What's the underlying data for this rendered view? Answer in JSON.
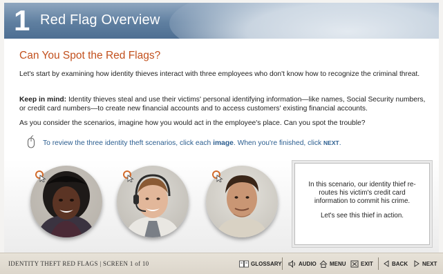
{
  "header": {
    "number": "1",
    "title": "Red Flag Overview"
  },
  "content": {
    "heading": "Can You Spot the Red Flags?",
    "intro": "Let's start by examining how identity thieves interact with three employees who don't know how to recognize the criminal threat.",
    "keep_in_mind_label": "Keep in mind:",
    "keep_in_mind_text": " Identity thieves steal and use their victims' personal identifying information—like names, Social Security numbers, or credit card numbers—to create new financial accounts and to access customers' existing financial accounts.",
    "consider": "As you consider the scenarios, imagine how you would act in the employee's place. Can you spot the trouble?",
    "instruction": {
      "part1": "To review the three identity theft scenarios, click each ",
      "bold": "image",
      "part2": ". When you're finished, click ",
      "next": "NEXT",
      "part3": "."
    }
  },
  "scenario": {
    "text": "In this scenario, our identity thief re-routes his victim's credit card information to commit his crime.",
    "cta": "Let's see this thief in action."
  },
  "footer": {
    "course": "IDENTITY THEFT RED FLAGS",
    "screen": "SCREEN 1 of 10",
    "divider": "|",
    "glossary": "GLOSSARY",
    "audio": "AUDIO",
    "menu": "MENU",
    "exit": "EXIT",
    "back": "BACK",
    "next": "NEXT"
  },
  "colors": {
    "heading": "#c2501d",
    "instruction": "#2a5d8f",
    "header": "#5f7fa0",
    "footer": "#e2ddd2"
  },
  "icons": [
    "mouse-icon",
    "click-cursor-icon",
    "glossary-icon",
    "audio-icon",
    "menu-home-icon",
    "exit-icon",
    "back-arrow-icon",
    "next-arrow-icon"
  ]
}
